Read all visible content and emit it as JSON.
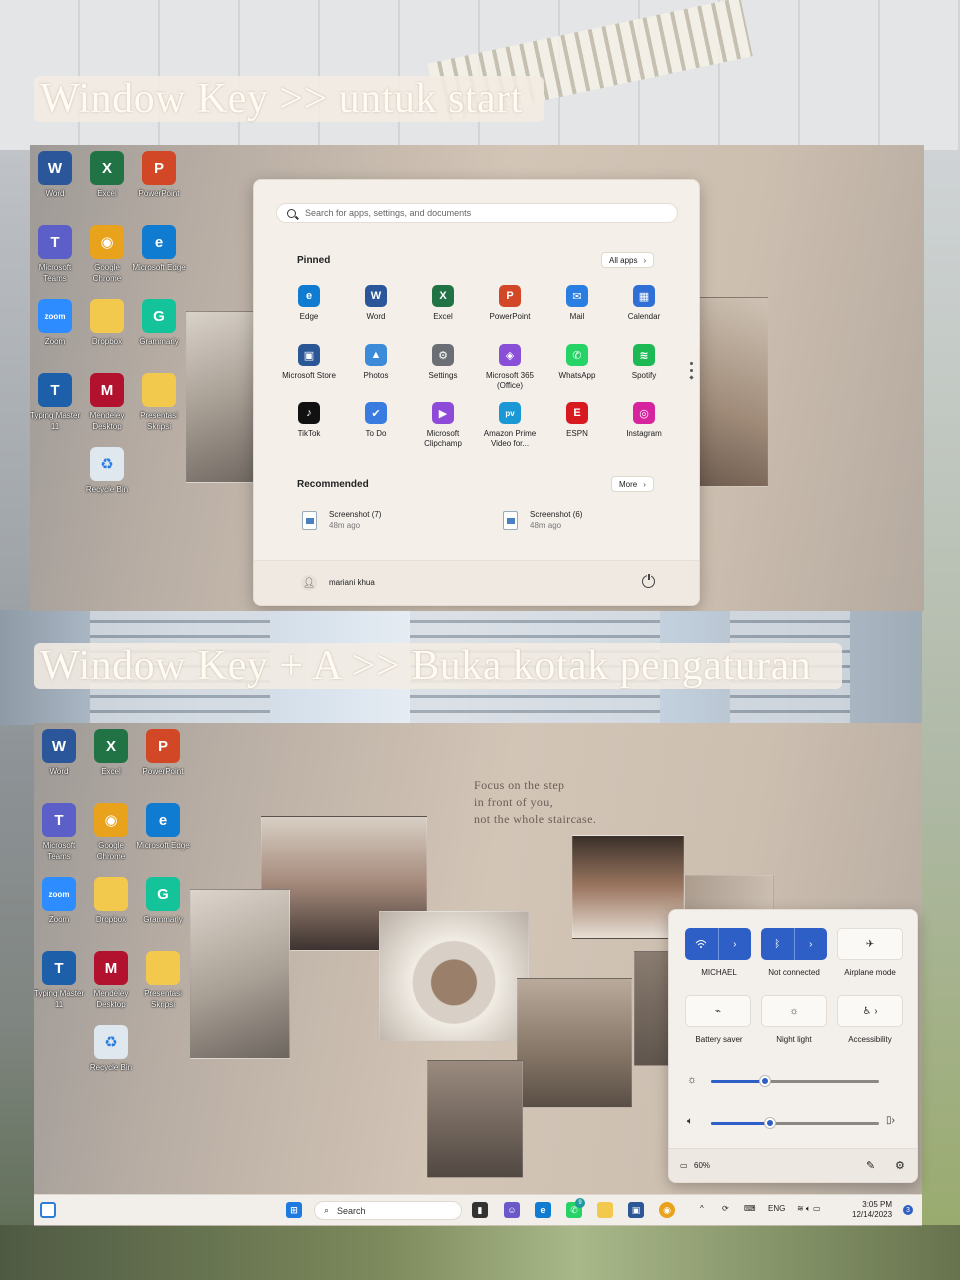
{
  "headings": {
    "top": "Window Key >> untuk start",
    "bottom": "Window Key + A >> Buka kotak pengaturan"
  },
  "desktop_icons": [
    {
      "label": "Word",
      "icon": "word-icon",
      "color": "#2b579a",
      "glyph": "W"
    },
    {
      "label": "Excel",
      "icon": "excel-icon",
      "color": "#217346",
      "glyph": "X"
    },
    {
      "label": "PowerPoint",
      "icon": "powerpoint-icon",
      "color": "#d24726",
      "glyph": "P"
    },
    {
      "label": "Microsoft Teams",
      "icon": "teams-icon",
      "color": "#5b5fc7",
      "glyph": "T"
    },
    {
      "label": "Google Chrome",
      "icon": "chrome-icon",
      "color": "#e8a21b",
      "glyph": "◉"
    },
    {
      "label": "Microsoft Edge",
      "icon": "edge-icon",
      "color": "#0f7bd1",
      "glyph": "e"
    },
    {
      "label": "Zoom",
      "icon": "zoom-icon",
      "color": "#2d8cff",
      "glyph": "zoom"
    },
    {
      "label": "Dropbox",
      "icon": "folder-icon",
      "color": "#f2c94c",
      "glyph": ""
    },
    {
      "label": "Grammarly",
      "icon": "grammarly-icon",
      "color": "#15c39a",
      "glyph": "G"
    },
    {
      "label": "Typing Master 11",
      "icon": "typingmaster-icon",
      "color": "#1d5fa8",
      "glyph": "T"
    },
    {
      "label": "Mendeley Desktop",
      "icon": "mendeley-icon",
      "color": "#b3122e",
      "glyph": "M"
    },
    {
      "label": "Presentasi Skripsi",
      "icon": "folder-icon",
      "color": "#f2c94c",
      "glyph": ""
    },
    {
      "label": "Recycle Bin",
      "icon": "recycle-bin-icon",
      "color": "#dfe8ef",
      "glyph": "♻"
    }
  ],
  "start_menu": {
    "search_placeholder": "Search for apps, settings, and documents",
    "pinned_title": "Pinned",
    "all_apps_label": "All apps",
    "pinned_apps": [
      {
        "label": "Edge",
        "icon": "edge-icon",
        "color": "#0f7bd1",
        "glyph": "e"
      },
      {
        "label": "Word",
        "icon": "word-icon",
        "color": "#2b579a",
        "glyph": "W"
      },
      {
        "label": "Excel",
        "icon": "excel-icon",
        "color": "#217346",
        "glyph": "X"
      },
      {
        "label": "PowerPoint",
        "icon": "powerpoint-icon",
        "color": "#d24726",
        "glyph": "P"
      },
      {
        "label": "Mail",
        "icon": "mail-icon",
        "color": "#2a7de1",
        "glyph": "✉"
      },
      {
        "label": "Calendar",
        "icon": "calendar-icon",
        "color": "#2f6fd6",
        "glyph": "▦"
      },
      {
        "label": "Microsoft Store",
        "icon": "store-icon",
        "color": "#2b5797",
        "glyph": "▣"
      },
      {
        "label": "Photos",
        "icon": "photos-icon",
        "color": "#3b8bd9",
        "glyph": "▲"
      },
      {
        "label": "Settings",
        "icon": "settings-icon",
        "color": "#6b6f75",
        "glyph": "⚙"
      },
      {
        "label": "Microsoft 365 (Office)",
        "icon": "office-icon",
        "color": "#8a4fd9",
        "glyph": "◈"
      },
      {
        "label": "WhatsApp",
        "icon": "whatsapp-icon",
        "color": "#25d366",
        "glyph": "✆"
      },
      {
        "label": "Spotify",
        "icon": "spotify-icon",
        "color": "#1db954",
        "glyph": "≋"
      },
      {
        "label": "TikTok",
        "icon": "tiktok-icon",
        "color": "#111111",
        "glyph": "♪"
      },
      {
        "label": "To Do",
        "icon": "todo-icon",
        "color": "#3a7be0",
        "glyph": "✔"
      },
      {
        "label": "Microsoft Clipchamp",
        "icon": "clipchamp-icon",
        "color": "#8e4ad8",
        "glyph": "▶"
      },
      {
        "label": "Amazon Prime Video for...",
        "icon": "prime-video-icon",
        "color": "#1a98d5",
        "glyph": "pv"
      },
      {
        "label": "ESPN",
        "icon": "espn-icon",
        "color": "#d71920",
        "glyph": "E"
      },
      {
        "label": "Instagram",
        "icon": "instagram-icon",
        "color": "#d6249f",
        "glyph": "◎"
      }
    ],
    "recommended_title": "Recommended",
    "more_label": "More",
    "recommended": [
      {
        "name": "Screenshot (7)",
        "time": "48m ago"
      },
      {
        "name": "Screenshot (6)",
        "time": "48m ago"
      }
    ],
    "user_name": "mariani khua"
  },
  "quote": [
    "Focus on the step",
    "in front of you,",
    "not the whole staircase."
  ],
  "quick_settings": {
    "tiles": [
      {
        "label": "MICHAEL",
        "icon": "wifi-icon",
        "state": "on"
      },
      {
        "label": "Not connected",
        "icon": "bluetooth-icon",
        "state": "on"
      },
      {
        "label": "Airplane mode",
        "icon": "airplane-icon",
        "state": "off"
      },
      {
        "label": "Battery saver",
        "icon": "battery-saver-icon",
        "state": "off"
      },
      {
        "label": "Night light",
        "icon": "night-light-icon",
        "state": "off"
      },
      {
        "label": "Accessibility",
        "icon": "accessibility-icon",
        "state": "off"
      }
    ],
    "brightness_level": 0.32,
    "volume_level": 0.35,
    "battery": "60%"
  },
  "taskbar": {
    "search_label": "Search",
    "language": "ENG",
    "time": "3:05 PM",
    "date": "12/14/2023",
    "notification_count": "3",
    "whatsapp_badge": "9"
  },
  "colors": {
    "accent": "#2d5fc6",
    "heading_bg": "#f3ece2",
    "start_bg": "#f4efe9"
  }
}
